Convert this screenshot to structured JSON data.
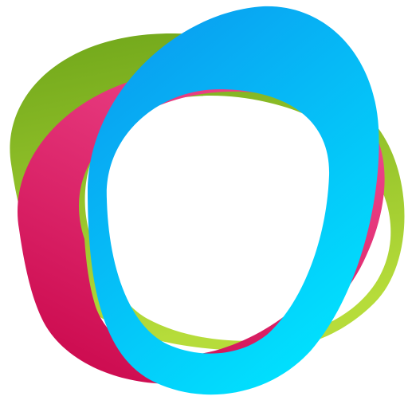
{
  "logo": {
    "rings": [
      {
        "name": "green-ring",
        "colors": [
          "#6fa61a",
          "#b6dc3a"
        ]
      },
      {
        "name": "pink-ring",
        "colors": [
          "#f04a8f",
          "#cc0a4e"
        ]
      },
      {
        "name": "blue-ring",
        "colors": [
          "#0a9cf0",
          "#00e6ff"
        ]
      }
    ],
    "background": "#ffffff"
  }
}
